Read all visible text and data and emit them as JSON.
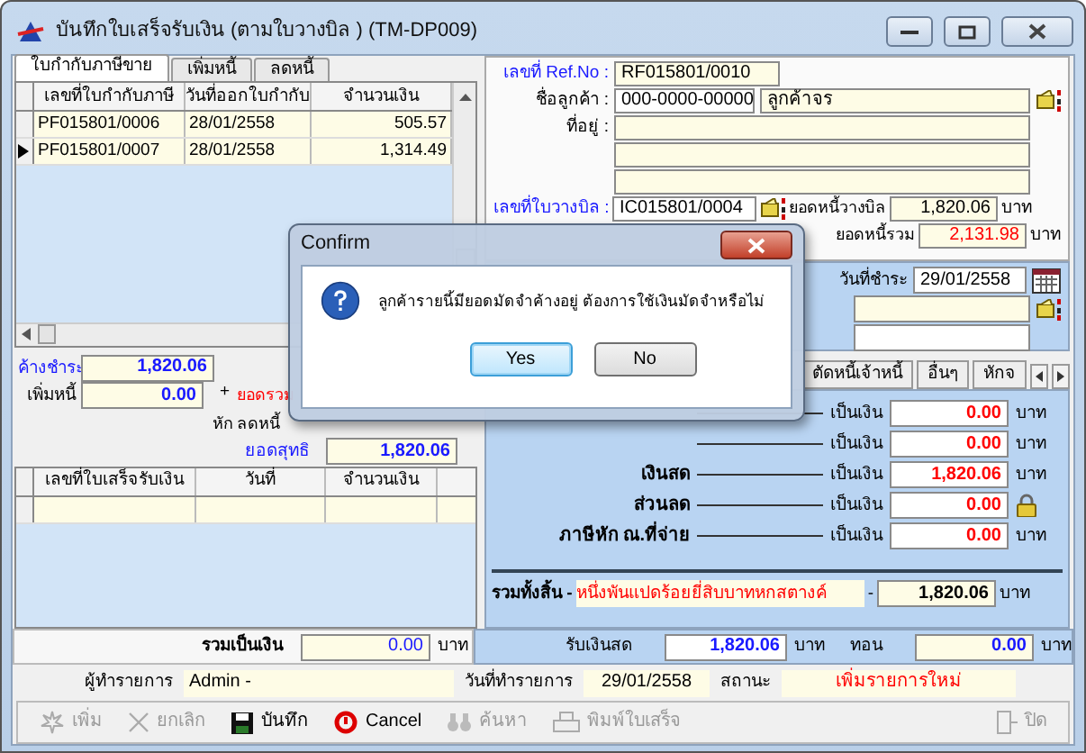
{
  "window": {
    "title": "บันทึกใบเสร็จรับเงิน (ตามใบวางบิล ) (TM-DP009)"
  },
  "left_tabs": [
    {
      "label": "ใบกำกับภาษีขาย",
      "selected": true
    },
    {
      "label": "เพิ่มหนี้",
      "selected": false
    },
    {
      "label": "ลดหนี้",
      "selected": false
    }
  ],
  "invoice_table": {
    "columns": [
      "เลขที่ใบกำกับภาษี",
      "วันที่ออกใบกำกับ",
      "จำนวนเงิน"
    ],
    "rows": [
      {
        "cells": [
          "PF015801/0006",
          "28/01/2558",
          "505.57"
        ],
        "current": false
      },
      {
        "cells": [
          "PF015801/0007",
          "28/01/2558",
          "1,314.49"
        ],
        "current": true
      }
    ]
  },
  "summary": {
    "outstanding_label": "ค้างชำระ",
    "outstanding": "1,820.06",
    "added_label": "เพิ่มหนี้",
    "added": "0.00",
    "plus": "+",
    "total_label": "ยอดรวม",
    "deduct_label": "หัก  ลดหนี้",
    "net_label": "ยอดสุทธิ",
    "net": "1,820.06"
  },
  "receipt_table": {
    "columns": [
      "เลขที่ใบเสร็จรับเงิน",
      "วันที่",
      "จำนวนเงิน"
    ]
  },
  "sum_row": {
    "label": "รวมเป็นเงิน",
    "value": "0.00",
    "unit": "บาท"
  },
  "form": {
    "ref_label": "เลขที่ Ref.No :",
    "ref": "RF015801/0010",
    "customer_label": "ชื่อลูกค้า :",
    "customer_code": "000-0000-00000",
    "customer_name": "ลูกค้าจร",
    "address_label": "ที่อยู่ :",
    "bill_label": "เลขที่ใบวางบิล :",
    "bill": "IC015801/0004",
    "bill_debt_label": "ยอดหนี้วางบิล",
    "bill_debt": "1,820.06",
    "bill_debt_unit": "บาท",
    "total_debt_label": "ยอดหนี้รวม",
    "total_debt": "2,131.98",
    "total_debt_unit": "บาท",
    "pay_date_label": "วันที่ชำระ",
    "pay_date": "29/01/2558"
  },
  "payment_tabs": [
    {
      "label": "ตัดหนี้เจ้าหนี้",
      "selected": false
    },
    {
      "label": "อื่นๆ",
      "selected": false
    },
    {
      "label": "หักจ",
      "selected": false
    }
  ],
  "payments": [
    {
      "kind": "unit",
      "as": "เป็นเงิน",
      "value": "0.00",
      "unit": "บาท"
    },
    {
      "kind": "unit",
      "as": "เป็นเงิน",
      "value": "0.00",
      "unit": "บาท"
    },
    {
      "kind": "unit",
      "label": "เงินสด",
      "as": "เป็นเงิน",
      "value": "1,820.06",
      "unit": "บาท"
    },
    {
      "kind": "lock",
      "label": "ส่วนลด",
      "as": "เป็นเงิน",
      "value": "0.00"
    },
    {
      "kind": "unit",
      "label": "ภาษีหัก ณ.ที่จ่าย",
      "as": "เป็นเงิน",
      "value": "0.00",
      "unit": "บาท"
    }
  ],
  "grand_total": {
    "label": "รวมทั้งสิ้น -",
    "words": "หนึ่งพันแปดร้อยยี่สิบบาทหกสตางค์",
    "dash": "-",
    "value": "1,820.06",
    "unit": "บาท"
  },
  "cash_row": {
    "label": "รับเงินสด",
    "value": "1,820.06",
    "unit": "บาท",
    "change_label": "ทอน",
    "change": "0.00",
    "change_unit": "บาท"
  },
  "footer": {
    "user_label": "ผู้ทำรายการ",
    "user": "Admin -",
    "date_label": "วันที่ทำรายการ",
    "date": "29/01/2558",
    "status_label": "สถานะ",
    "status": "เพิ่มรายการใหม่"
  },
  "toolbar": [
    {
      "label": "เพิ่ม",
      "disabled": true
    },
    {
      "label": "ยกเลิก",
      "disabled": true
    },
    {
      "label": "บันทึก",
      "disabled": false
    },
    {
      "label": "Cancel",
      "disabled": false
    },
    {
      "label": "ค้นหา",
      "disabled": true
    },
    {
      "label": "พิมพ์ใบเสร็จ",
      "disabled": true
    },
    {
      "label": "ปิด",
      "disabled": true
    }
  ],
  "dialog": {
    "title": "Confirm",
    "message": "ลูกค้ารายนี้มียอดมัดจำค้างอยู่ ต้องการใช้เงินมัดจำหรือไม่",
    "buttons": [
      {
        "label": "Yes",
        "default": true
      },
      {
        "label": "No",
        "default": false
      }
    ]
  }
}
